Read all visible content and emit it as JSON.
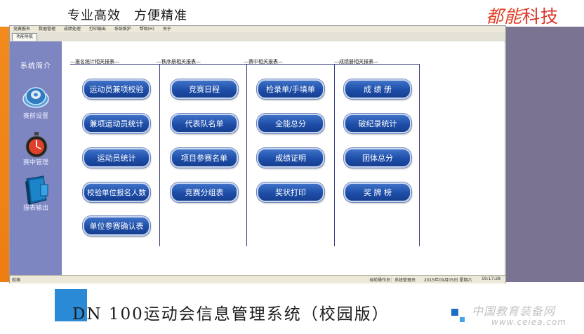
{
  "banner": {
    "slogan": "专业高效　方便精准",
    "brand_part1": "都能",
    "brand_part2": "科技"
  },
  "menubar": {
    "items": [
      "竞赛报名",
      "数据管理",
      "成绩处理",
      "打印输出",
      "系统维护",
      "帮助(H)",
      "关于"
    ]
  },
  "tab": {
    "label": "功能导航"
  },
  "sidebar": {
    "title": "系统简介",
    "items": [
      {
        "label": "赛前设置",
        "icon": "disc-icon"
      },
      {
        "label": "赛中管理",
        "icon": "stopwatch-icon"
      },
      {
        "label": "报表输出",
        "icon": "book-icon"
      }
    ]
  },
  "groups": [
    {
      "title": "—报名统计相关报表—",
      "buttons": [
        "运动员兼项校验",
        "兼项运动员统计",
        "运动员统计",
        "校验单位报名人数",
        "单位参赛确认表"
      ]
    },
    {
      "title": "—秩序册相关报表—",
      "buttons": [
        "竞赛日程",
        "代表队名单",
        "项目参赛名单",
        "竞赛分组表"
      ]
    },
    {
      "title": "—赛中相关报表—",
      "buttons": [
        "检录单/手填单",
        "全能总分",
        "成绩证明",
        "奖状打印"
      ]
    },
    {
      "title": "—成绩册相关报表—",
      "buttons": [
        "成 绩 册",
        "破纪录统计",
        "团体总分",
        "奖 牌 榜"
      ]
    }
  ],
  "statusbar": {
    "left": "就绪",
    "middle": "当前操作员：系统管理员",
    "date": "2015年09月05日 星期六",
    "time": "19:17:28"
  },
  "footer": {
    "title": "DN 100运动会信息管理系统（校园版）",
    "watermark_cn": "中国教育装备网",
    "watermark_url": "www.ceiea.com"
  },
  "colors": {
    "orange_bar": "#f28a1e",
    "sidebar": "#7d86c0",
    "button": "#1e4ea8",
    "purple_block": "#7b7392",
    "blue_square": "#2a8ad6",
    "brand_red": "#e0442a"
  }
}
